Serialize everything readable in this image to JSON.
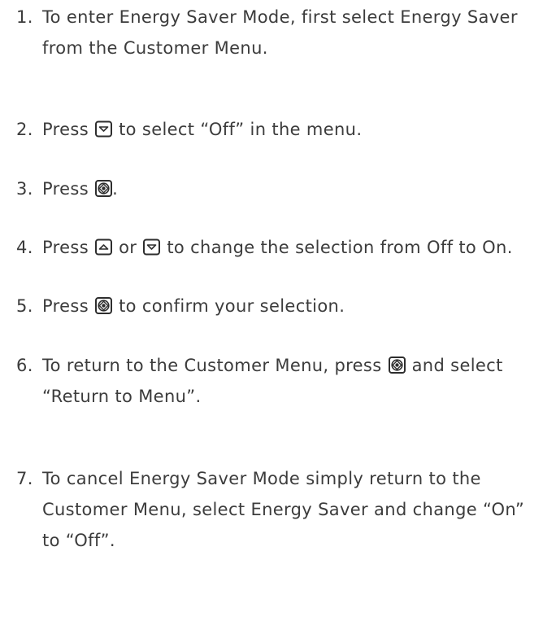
{
  "steps": [
    {
      "number": "1.",
      "lines": [
        "To enter Energy Saver Mode, first select Energy Saver",
        "from the Customer Menu."
      ]
    },
    {
      "number": "2.",
      "before": "Press",
      "after": "to select “Off” in the menu."
    },
    {
      "number": "3.",
      "before": "Press",
      "after": "."
    },
    {
      "number": "4.",
      "before": "Press",
      "middle": "or",
      "after": "to change the selection from Off to On."
    },
    {
      "number": "5.",
      "before": "Press",
      "after": "to confirm your selection."
    },
    {
      "number": "6.",
      "before": "To return to the Customer Menu, press",
      "after": "and select",
      "line2": "“Return to Menu”."
    },
    {
      "number": "7.",
      "lines": [
        "To cancel Energy Saver Mode simply return to the",
        "Customer Menu, select Energy Saver and change “On”",
        "to “Off”."
      ]
    }
  ],
  "icons": {
    "down": "down-arrow-button-icon",
    "up": "up-arrow-button-icon",
    "select": "select-button-icon"
  }
}
